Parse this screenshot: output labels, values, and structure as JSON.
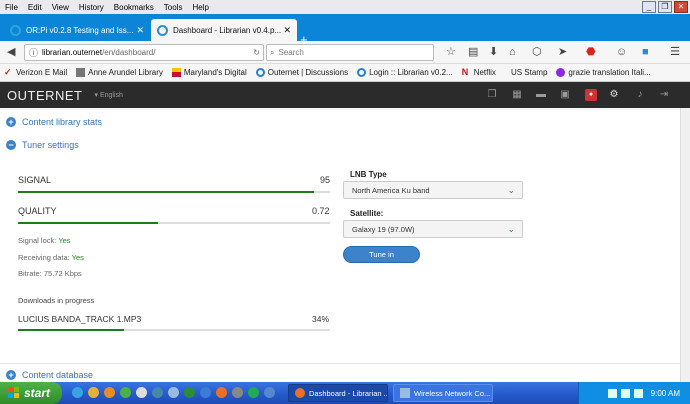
{
  "menu": [
    "File",
    "Edit",
    "View",
    "History",
    "Bookmarks",
    "Tools",
    "Help"
  ],
  "window_controls": {
    "minimize": "_",
    "restore": "❐",
    "close": "✕"
  },
  "tabs": [
    {
      "title": "OR:Pi v0.2.8 Testing and Iss...",
      "close": "✕"
    },
    {
      "title": "Dashboard - Librarian v0.4.p...",
      "close": "✕"
    }
  ],
  "new_tab": "+",
  "address": {
    "host": "librarian.outernet",
    "path": "/en/dashboard/"
  },
  "search": {
    "placeholder": "Search"
  },
  "bookmarks": [
    {
      "label": "Verizon E Mail",
      "icon": "verizon-icon"
    },
    {
      "label": "Anne Arundel Library",
      "icon": "library-icon"
    },
    {
      "label": "Maryland's Digital",
      "icon": "maryland-icon"
    },
    {
      "label": "Outernet | Discussions",
      "icon": "outernet-icon"
    },
    {
      "label": "Login :: Librarian v0.2...",
      "icon": "outernet-icon"
    },
    {
      "label": "Netflix",
      "icon": "netflix-icon"
    },
    {
      "label": "US Stamp",
      "icon": ""
    },
    {
      "label": "grazie translation Itali...",
      "icon": "translate-icon"
    }
  ],
  "app": {
    "brand": "OUTERNET",
    "language": "English"
  },
  "sections": {
    "library_stats": "Content library stats",
    "tuner": "Tuner settings",
    "database": "Content database"
  },
  "tuner": {
    "signal": {
      "label": "SIGNAL",
      "value": "95",
      "fraction": 0.95
    },
    "quality": {
      "label": "QUALITY",
      "value": "0.72",
      "fraction": 0.45
    },
    "signal_lock": {
      "label": "Signal lock:",
      "value": "Yes"
    },
    "receiving": {
      "label": "Receiving data:",
      "value": "Yes"
    },
    "bitrate": {
      "label": "Bitrate:",
      "value": "75.72 Kbps"
    },
    "downloads_heading": "Downloads in progress",
    "download": {
      "name": "LUCIUS BANDA_TRACK 1.MP3",
      "percent": "34%",
      "fraction": 0.34
    },
    "lnb_label": "LNB Type",
    "lnb_value": "North America Ku band",
    "satellite_label": "Satellite:",
    "satellite_value": "Galaxy 19 (97.0W)",
    "tune_button": "Tune in"
  },
  "taskbar": {
    "start": "start",
    "tasks": [
      "Dashboard - Librarian ...",
      "Wireless Network Co..."
    ],
    "clock": "9:00 AM"
  },
  "colors": {
    "accent": "#3a84c7",
    "meter": "#1e7c1e",
    "topbar": "#2b2b2b",
    "tabstrip": "#0b85d8"
  }
}
